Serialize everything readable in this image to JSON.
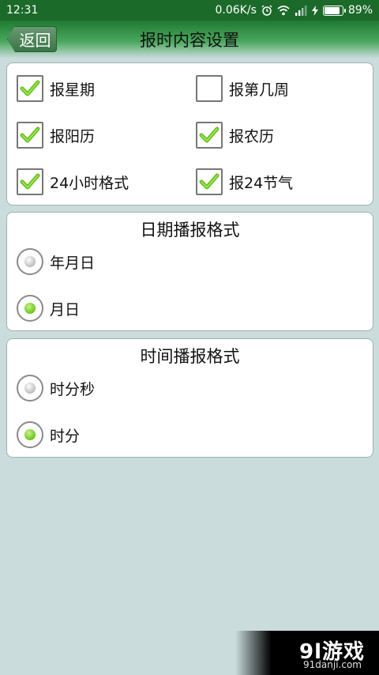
{
  "status_bar": {
    "time": "12:31",
    "network_speed": "0.06K/s",
    "battery_percent": "89%",
    "battery_level": 0.89,
    "icons": [
      "alarm-icon",
      "wifi-icon",
      "signal-icon",
      "charging-icon",
      "battery-icon"
    ]
  },
  "header": {
    "back_label": "返回",
    "title": "报时内容设置"
  },
  "options": {
    "items": [
      {
        "label": "报星期",
        "checked": true
      },
      {
        "label": "报第几周",
        "checked": false
      },
      {
        "label": "报阳历",
        "checked": true
      },
      {
        "label": "报农历",
        "checked": true
      },
      {
        "label": "24小时格式",
        "checked": true
      },
      {
        "label": "报24节气",
        "checked": true
      }
    ]
  },
  "date_format": {
    "title": "日期播报格式",
    "options": [
      {
        "label": "年月日",
        "selected": false
      },
      {
        "label": "月日",
        "selected": true
      }
    ]
  },
  "time_format": {
    "title": "时间播报格式",
    "options": [
      {
        "label": "时分秒",
        "selected": false
      },
      {
        "label": "时分",
        "selected": true
      }
    ]
  },
  "watermark": {
    "logo": "9l游戏",
    "url": "91danji.com"
  },
  "colors": {
    "status_bar": "#1c6a2a",
    "header_green": "#1f7a31",
    "background": "#cbdcdd",
    "check_green": "#66c21a"
  }
}
